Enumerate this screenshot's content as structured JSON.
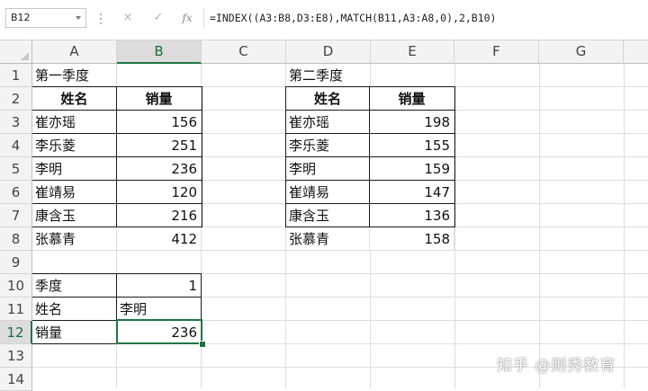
{
  "formula_bar": {
    "name_box": "B12",
    "cancel_icon": "×",
    "enter_icon": "✓",
    "fx_label": "fx",
    "formula": "=INDEX((A3:B8,D3:E8),MATCH(B11,A3:A8,0),2,B10)"
  },
  "columns": [
    "A",
    "B",
    "C",
    "D",
    "E",
    "F",
    "G"
  ],
  "selected_column": "B",
  "rows": [
    "1",
    "2",
    "3",
    "4",
    "5",
    "6",
    "7",
    "8",
    "9",
    "10",
    "11",
    "12",
    "13",
    "14"
  ],
  "selected_row": "12",
  "sheet": {
    "q1_title": "第一季度",
    "q2_title": "第二季度",
    "table_headers": {
      "name": "姓名",
      "sales": "销量"
    },
    "q1_rows": [
      {
        "name": "崔亦瑶",
        "sales": "156"
      },
      {
        "name": "李乐菱",
        "sales": "251"
      },
      {
        "name": "李明",
        "sales": "236"
      },
      {
        "name": "崔靖易",
        "sales": "120"
      },
      {
        "name": "康含玉",
        "sales": "216"
      },
      {
        "name": "张慕青",
        "sales": "412"
      }
    ],
    "q2_rows": [
      {
        "name": "崔亦瑶",
        "sales": "198"
      },
      {
        "name": "李乐菱",
        "sales": "155"
      },
      {
        "name": "李明",
        "sales": "159"
      },
      {
        "name": "崔靖易",
        "sales": "147"
      },
      {
        "name": "康含玉",
        "sales": "136"
      },
      {
        "name": "张慕青",
        "sales": "158"
      }
    ],
    "lookup": {
      "quarter_label": "季度",
      "quarter_value": "1",
      "name_label": "姓名",
      "name_value": "李明",
      "sales_label": "销量",
      "sales_value": "236"
    }
  },
  "watermark": "知乎 @则秀教育",
  "colors": {
    "accent": "#217346",
    "header_bg": "#f3f3f3",
    "grid": "#dedede"
  }
}
